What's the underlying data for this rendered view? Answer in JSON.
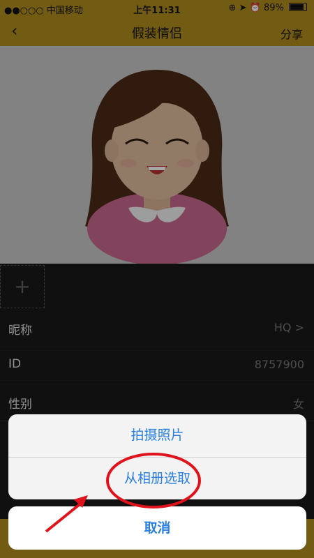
{
  "status": {
    "carrier": "●●○○○ 中国移动",
    "time": "上午11:31",
    "battery": "89%"
  },
  "nav": {
    "back_icon": "chevron-left-icon",
    "title": "假装情侣",
    "share_label": "分享"
  },
  "profile": {
    "add_symbol": "+",
    "rows": [
      {
        "label": "昵称",
        "value": "HQ >"
      },
      {
        "label": "ID",
        "value": "8757900"
      },
      {
        "label": "性别",
        "value": "女"
      }
    ]
  },
  "action_sheet": {
    "take_photo": "拍摄照片",
    "choose_album": "从相册选取",
    "cancel": "取消"
  },
  "colors": {
    "accent": "#b08e1e",
    "action_blue": "#2a7fe0",
    "annotation_red": "#e0121b"
  }
}
